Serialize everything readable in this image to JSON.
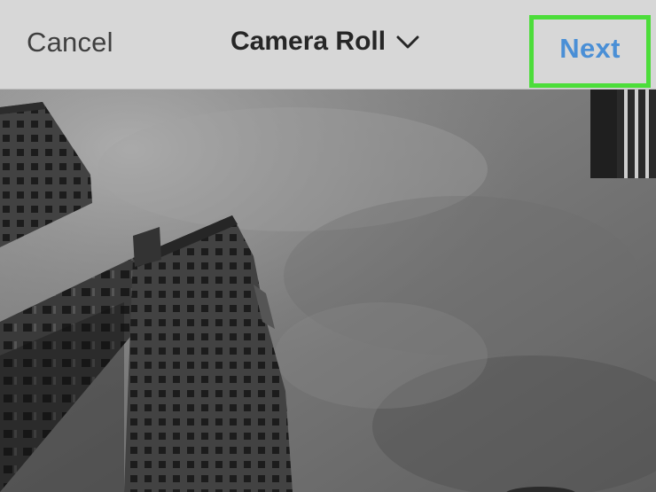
{
  "navbar": {
    "cancel_label": "Cancel",
    "album_label": "Camera Roll",
    "album_icon": "chevron-down-icon",
    "next_label": "Next",
    "next_color": "#4a8fd6",
    "highlight_color": "#4cdd3a"
  },
  "photo": {
    "content": "grayscale upward view of high-rise buildings against a cloudy sky"
  }
}
